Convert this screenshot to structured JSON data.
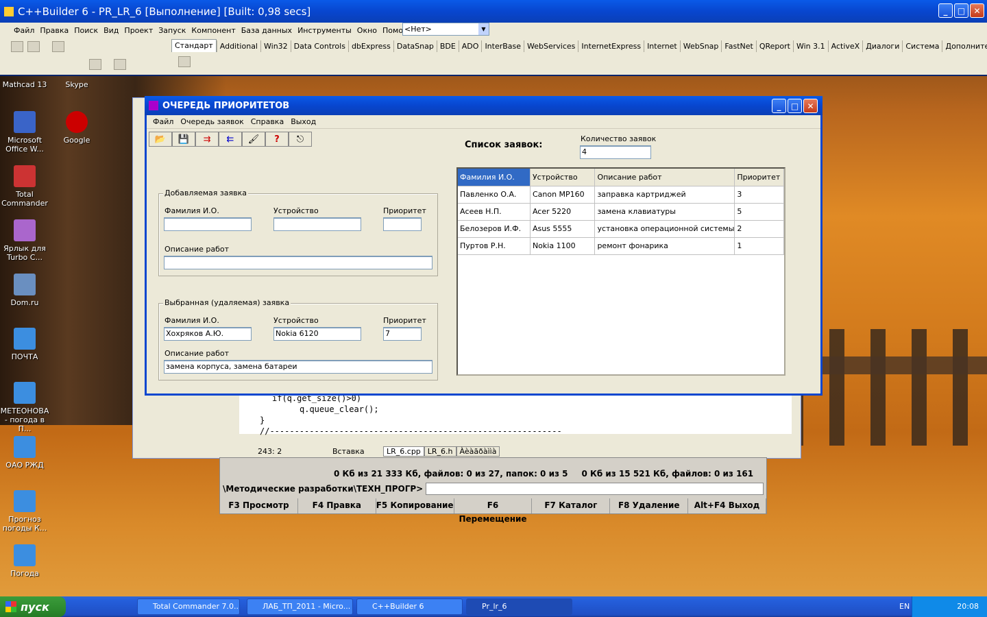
{
  "builder": {
    "title": "C++Builder 6 - PR_LR_6 [Выполнение] [Built: 0,98 secs]",
    "menu": [
      "Файл",
      "Правка",
      "Поиск",
      "Вид",
      "Проект",
      "Запуск",
      "Компонент",
      "База данных",
      "Инструменты",
      "Окно",
      "Помощь"
    ],
    "combo_value": "<Нет>",
    "palette_tabs": [
      "Стандарт",
      "Additional",
      "Win32",
      "Data Controls",
      "dbExpress",
      "DataSnap",
      "BDE",
      "ADO",
      "InterBase",
      "WebServices",
      "InternetExpress",
      "Internet",
      "WebSnap",
      "FastNet",
      "QReport",
      "Win 3.1",
      "ActiveX",
      "Диалоги",
      "Система",
      "Дополнительно"
    ]
  },
  "desktop_icons": [
    {
      "label": "Mathcad 13"
    },
    {
      "label": "Skype"
    },
    {
      "label": "Microsoft Office W..."
    },
    {
      "label": "Google"
    },
    {
      "label": "Total Commander"
    },
    {
      "label": "Ярлык для Turbo C..."
    },
    {
      "label": "Dom.ru"
    },
    {
      "label": "ПОЧТА"
    },
    {
      "label": "МЕТЕОНОВА - погода в П..."
    },
    {
      "label": "ОАО РЖД"
    },
    {
      "label": "Прогноз погоды К..."
    },
    {
      "label": "Погода"
    }
  ],
  "editor": {
    "code_line1": "if(q.get_size()>0)",
    "code_line2": "q.queue_clear();",
    "code_line3": "}",
    "code_line4": "//-----------------------------------------------------------",
    "status_pos": "243:  2",
    "status_mode": "Вставка",
    "tabs": [
      "LR_6.cpp",
      "LR_6.h",
      "Àèàãðàììà"
    ]
  },
  "total_commander": {
    "info_left": "0 Кб из 21 333 Кб, файлов: 0 из 27, папок: 0 из 5",
    "info_right": "0 Кб из 15 521 Кб, файлов: 0 из 161",
    "path": "\\Методические разработки\\ТЕХН_ПРОГР>",
    "fkeys": [
      "F3 Просмотр",
      "F4 Правка",
      "F5 Копирование",
      "F6 Перемещение",
      "F7 Каталог",
      "F8 Удаление",
      "Alt+F4 Выход"
    ]
  },
  "dialog": {
    "title": "ОЧЕРЕДЬ  ПРИОРИТЕТОВ",
    "menu": [
      "Файл",
      "Очередь заявок",
      "Справка",
      "Выход"
    ],
    "list_title": "Список заявок:",
    "count_label": "Количество заявок",
    "count_value": "4",
    "add_group": {
      "caption": "Добавляемая заявка",
      "name_label": "Фамилия И.О.",
      "device_label": "Устройство",
      "priority_label": "Приоритет",
      "desc_label": "Описание работ",
      "name_value": "",
      "device_value": "",
      "priority_value": "",
      "desc_value": ""
    },
    "sel_group": {
      "caption": "Выбранная (удаляемая) заявка",
      "name_label": "Фамилия И.О.",
      "device_label": "Устройство",
      "priority_label": "Приоритет",
      "desc_label": "Описание работ",
      "name_value": "Хохряков А.Ю.",
      "device_value": "Nokia 6120",
      "priority_value": "7",
      "desc_value": "замена корпуса, замена батареи"
    },
    "grid": {
      "headers": [
        "Фамилия И.О.",
        "Устройство",
        "Описание работ",
        "Приоритет"
      ],
      "rows": [
        [
          "Павленко О.А.",
          "Canon MP160",
          "заправка картриджей",
          "3"
        ],
        [
          "Асеев Н.П.",
          "Acer 5220",
          "замена клавиатуры",
          "5"
        ],
        [
          "Белозеров И.Ф.",
          "Asus 5555",
          "установка операционной системы",
          "2"
        ],
        [
          "Пуртов Р.Н.",
          "Nokia 1100",
          "ремонт фонарика",
          "1"
        ]
      ]
    }
  },
  "taskbar": {
    "start": "пуск",
    "tasks": [
      "Total Commander 7.0...",
      "ЛАБ_ТП_2011 - Micro...",
      "C++Builder 6",
      "Pr_lr_6"
    ],
    "lang": "EN",
    "clock": "20:08"
  }
}
